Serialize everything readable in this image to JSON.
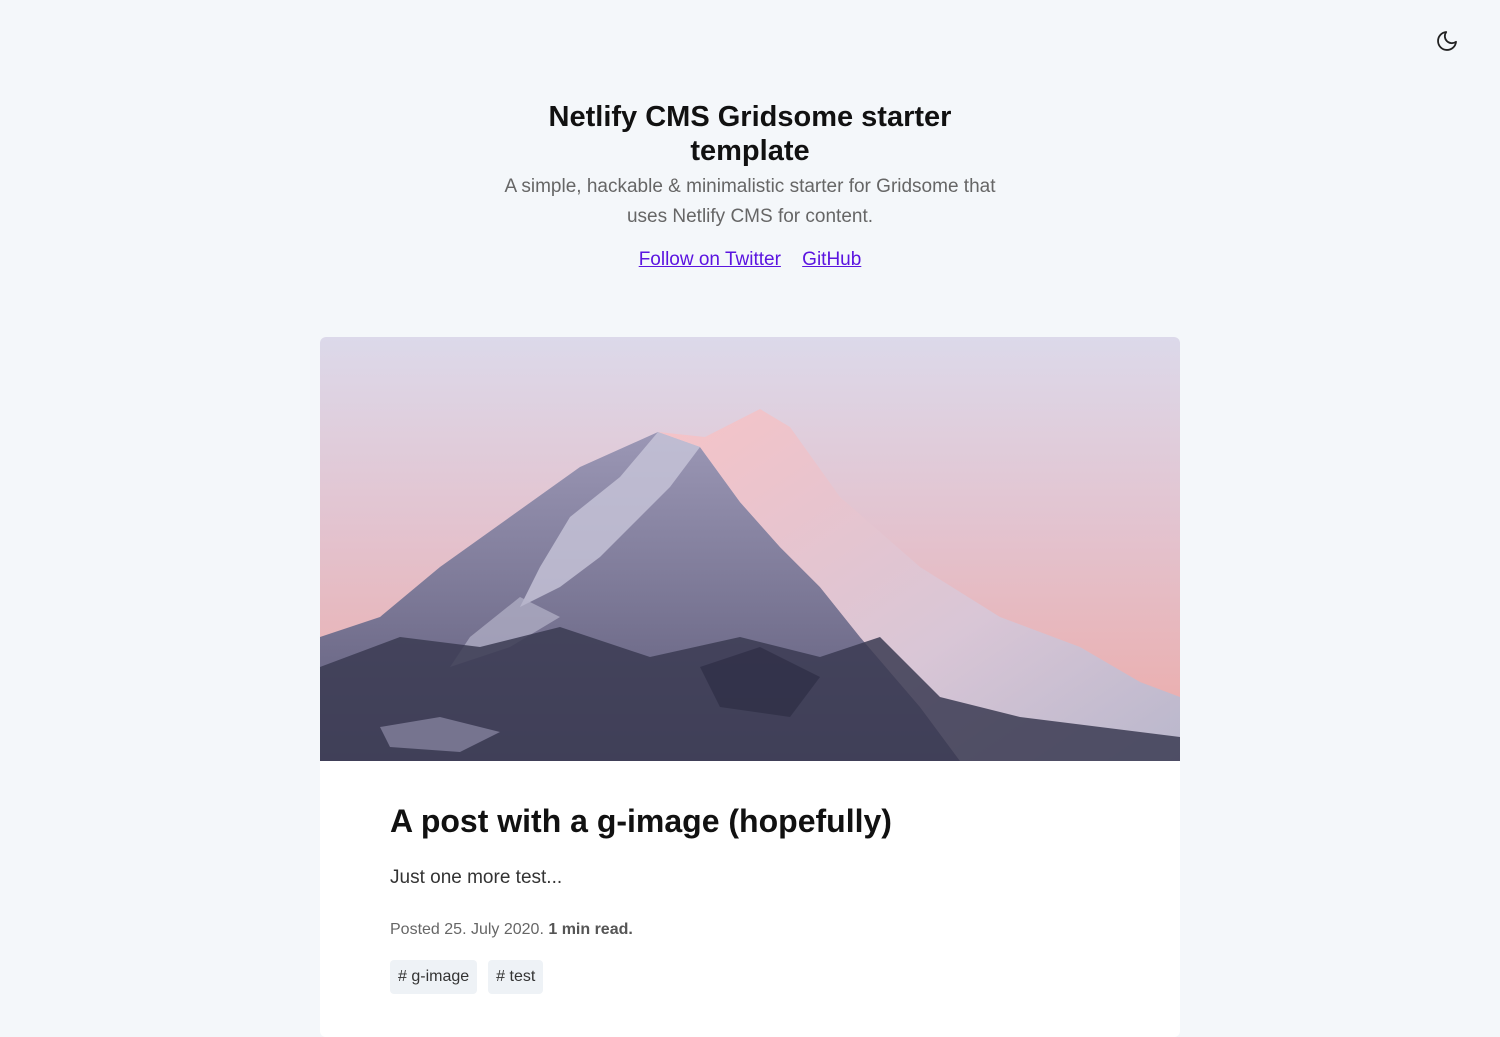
{
  "header": {
    "title": "Netlify CMS Gridsome starter template",
    "description": "A simple, hackable & minimalistic starter for Gridsome that uses Netlify CMS for content.",
    "links": [
      {
        "label": "Follow on Twitter"
      },
      {
        "label": "GitHub"
      }
    ]
  },
  "theme_toggle": {
    "icon": "moon-icon"
  },
  "post": {
    "title": "A post with a g-image (hopefully)",
    "excerpt": "Just one more test...",
    "meta": {
      "posted_prefix": "Posted",
      "date": "25. July 2020.",
      "read_time": "1 min read."
    },
    "tags": [
      {
        "label": "# g-image"
      },
      {
        "label": "# test"
      }
    ]
  },
  "colors": {
    "background": "#f4f7fa",
    "link": "#5b14e0",
    "card": "#ffffff",
    "tag_bg": "#eef2f6"
  }
}
